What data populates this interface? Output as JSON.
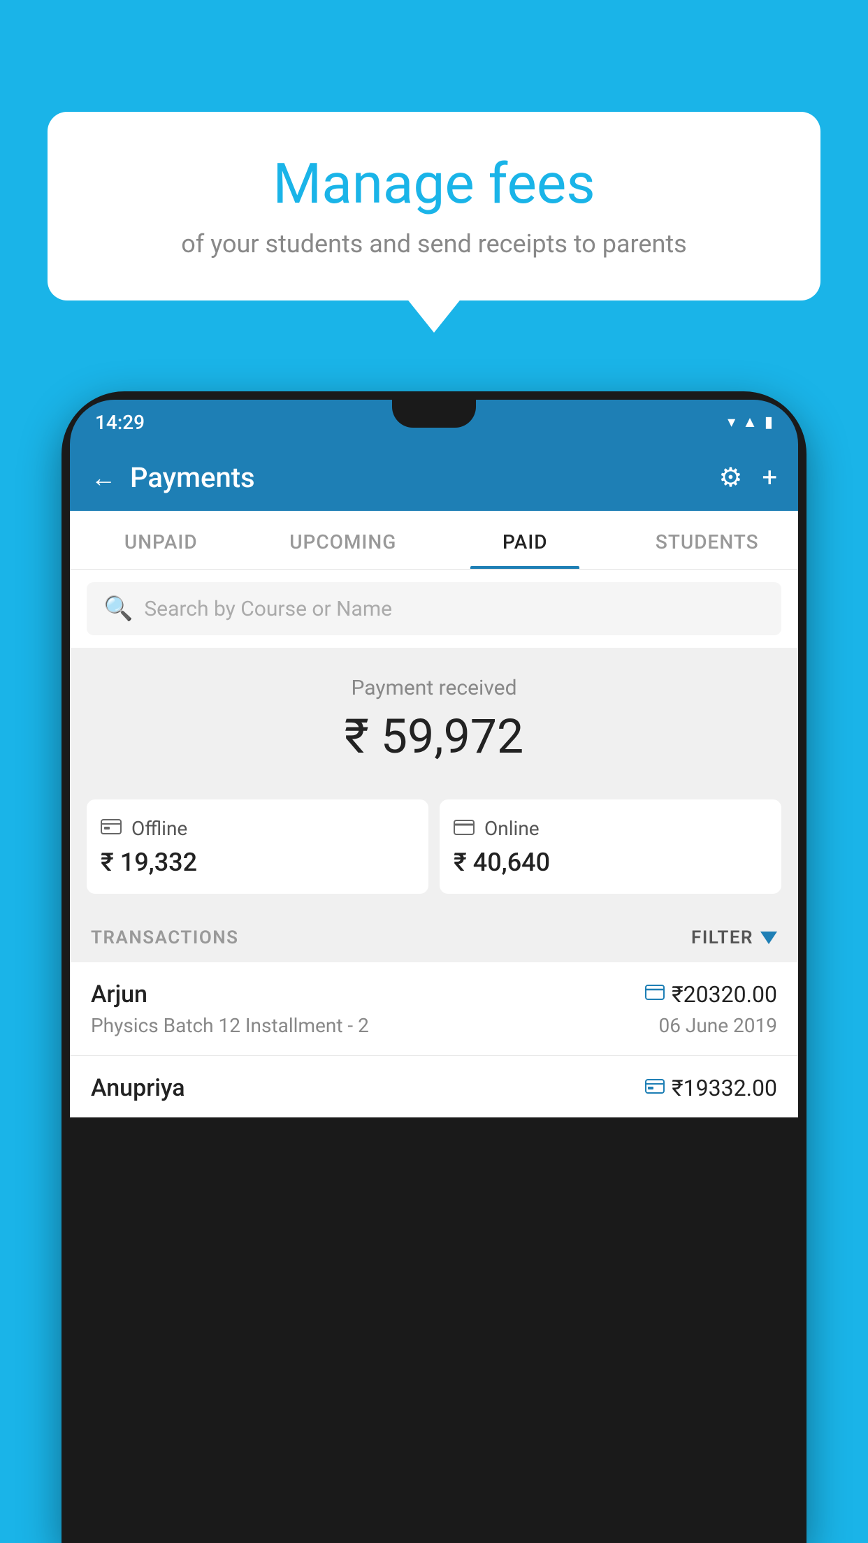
{
  "background_color": "#1ab4e8",
  "speech_bubble": {
    "title": "Manage fees",
    "subtitle": "of your students and send receipts to parents"
  },
  "phone": {
    "status_bar": {
      "time": "14:29",
      "icons": [
        "wifi",
        "signal",
        "battery"
      ]
    },
    "header": {
      "title": "Payments",
      "back_label": "←",
      "gear_icon": "⚙",
      "plus_icon": "+"
    },
    "tabs": [
      {
        "label": "UNPAID",
        "active": false
      },
      {
        "label": "UPCOMING",
        "active": false
      },
      {
        "label": "PAID",
        "active": true
      },
      {
        "label": "STUDENTS",
        "active": false
      }
    ],
    "search": {
      "placeholder": "Search by Course or Name"
    },
    "payment_received": {
      "label": "Payment received",
      "amount": "₹ 59,972",
      "cards": [
        {
          "type": "Offline",
          "amount": "₹ 19,332",
          "icon": "📋"
        },
        {
          "type": "Online",
          "amount": "₹ 40,640",
          "icon": "💳"
        }
      ]
    },
    "transactions_section": {
      "label": "TRANSACTIONS",
      "filter_label": "FILTER"
    },
    "transactions": [
      {
        "name": "Arjun",
        "amount": "₹20320.00",
        "course": "Physics Batch 12 Installment - 2",
        "date": "06 June 2019",
        "payment_method": "card"
      },
      {
        "name": "Anupriya",
        "amount": "₹19332.00",
        "course": "",
        "date": "",
        "payment_method": "offline"
      }
    ]
  }
}
